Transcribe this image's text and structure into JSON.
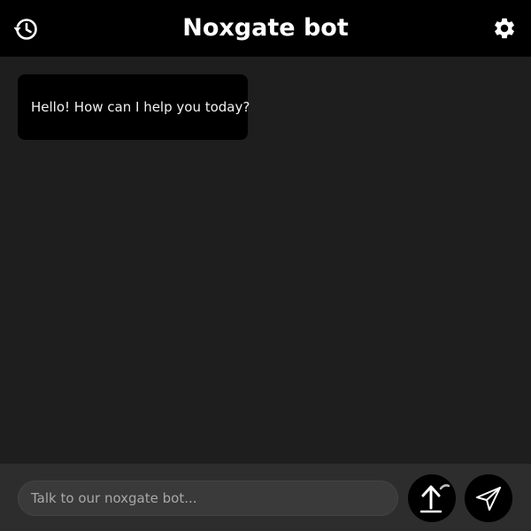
{
  "header": {
    "title": "Noxgate bot",
    "history_icon": "history-clock-icon",
    "settings_icon": "gear-icon"
  },
  "messages": [
    {
      "sender": "bot",
      "text": "Hello! How can I help you today?"
    }
  ],
  "composer": {
    "input_value": "",
    "input_placeholder": "Talk to our noxgate bot...",
    "upload_icon": "upload-icon",
    "send_icon": "send-icon"
  },
  "colors": {
    "header_bg": "#000000",
    "chat_bg": "#1e1e1e",
    "footer_bg": "#2d2d2d",
    "bubble_bg": "#000000",
    "text": "#ffffff"
  }
}
